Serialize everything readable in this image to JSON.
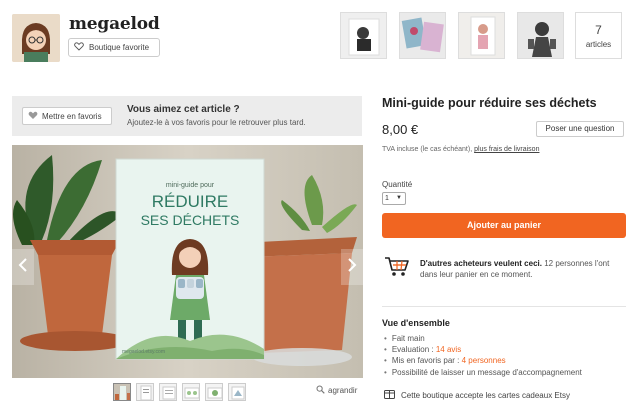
{
  "shop": {
    "name": "megaelod",
    "favorite_button": "Boutique favorite",
    "articles_count": "7",
    "articles_label": "articles"
  },
  "favorites_banner": {
    "button": "Mettre en favoris",
    "title": "Vous aimez cet article ?",
    "subtitle": "Ajoutez-le à vos favoris pour le retrouver plus tard."
  },
  "gallery": {
    "zoom_label": "agrandir",
    "watermark": "megaelod.etsy.com"
  },
  "product": {
    "title": "Mini-guide pour réduire ses déchets",
    "price": "8,00 €",
    "ask_button": "Poser une question",
    "tax_text": "TVA incluse (le cas échéant),",
    "shipping_link": "plus frais de livraison",
    "quantity_label": "Quantité",
    "quantity_value": "1",
    "add_to_cart": "Ajouter au panier",
    "cart_note_bold": "D'autres acheteurs veulent ceci.",
    "cart_note_rest": "12 personnes l'ont dans leur panier en ce moment.",
    "overview_title": "Vue d'ensemble",
    "overview": {
      "handmade": "Fait main",
      "rating_prefix": "Evaluation :",
      "rating_link": "14 avis",
      "favorited_prefix": "Mis en favoris par :",
      "favorited_link": "4 personnes",
      "gift_message": "Possibilité de laisser un message d'accompagnement"
    },
    "gift_card_note": "Cette boutique accepte les cartes cadeaux Etsy"
  },
  "booklet": {
    "line1": "mini-guide pour",
    "line2": "RÉDUIRE",
    "line3": "SES DÉCHETS"
  },
  "colors": {
    "accent": "#f16521",
    "banner_bg": "#ececec"
  }
}
